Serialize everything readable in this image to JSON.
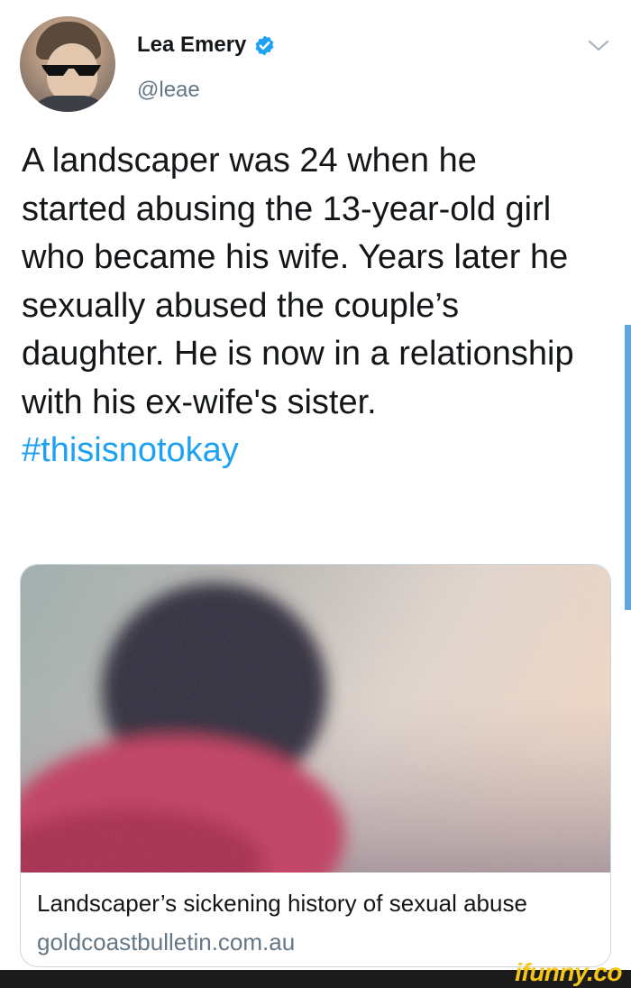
{
  "tweet": {
    "author": {
      "name": "Lea Emery",
      "handle": "@leae",
      "verified": true
    },
    "text_parts": {
      "body": "A landscaper was 24 when he started abusing the 13-year-old girl who became his wife. Years later he sexually abused the couple’s daughter. He is now in a relationship with his ex-wife's sister.",
      "hashtag": "#thisisnotokay"
    },
    "card": {
      "title": "Landscaper’s sickening history of sexual abuse",
      "domain": "goldcoastbulletin.com.au"
    }
  },
  "watermark": {
    "text": "ifunny.co"
  },
  "colors": {
    "link": "#1da1f2",
    "verified": "#1da1f2",
    "muted": "#657786",
    "scrollbar": "#5ea8df",
    "watermark": "#f5c518"
  },
  "icons": {
    "verified": "verified-badge-icon",
    "menu": "chevron-down-icon"
  }
}
